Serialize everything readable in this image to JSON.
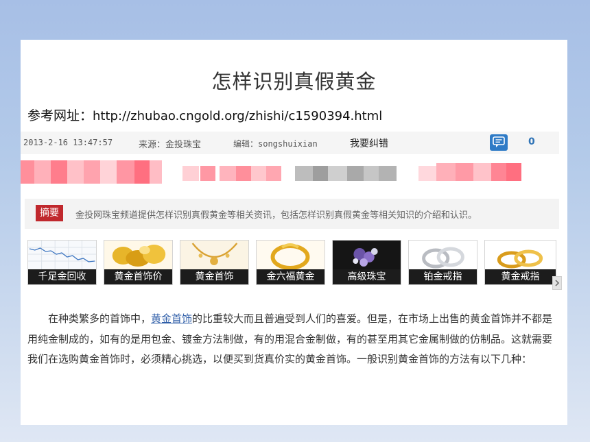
{
  "article": {
    "title": "怎样识别真假黄金",
    "reference_label": "参考网址：",
    "reference_url": "http://zhubao.cngold.org/zhishi/c1590394.html"
  },
  "meta": {
    "datetime": "2013-2-16 13:47:57",
    "source": "来源：金投珠宝",
    "editor": "编辑：songshuixian",
    "report_error": "我要纠错",
    "comment_count": "0",
    "comment_icon": "comment-bubble-icon"
  },
  "summary": {
    "tag": "摘要",
    "text": "金投网珠宝频道提供怎样识别真假黄金等相关资讯，包括怎样识别真假黄金等相关知识的介绍和认识。"
  },
  "thumbnails": [
    {
      "label": "千足金回收"
    },
    {
      "label": "黄金首饰价"
    },
    {
      "label": "黄金首饰"
    },
    {
      "label": "金六福黄金"
    },
    {
      "label": "高级珠宝"
    },
    {
      "label": "铂金戒指"
    },
    {
      "label": "黄金戒指"
    }
  ],
  "body": {
    "p1_before": "在种类繁多的首饰中，",
    "p1_link": "黄金首饰",
    "p1_after": "的比重较大而且普遍受到人们的喜爱。但是，在市场上出售的黄金首饰并不都是用纯金制成的，如有的是用包金、镀金方法制做，有的用混合金制做，有的甚至用其它金属制做的仿制品。这就需要我们在选购黄金首饰时，必须精心挑选，以便买到货真价实的黄金首饰。一般识别黄金首饰的方法有以下几种："
  },
  "colors": {
    "summary_tag_bg": "#c0282d",
    "link": "#2f5ea8",
    "comment_button": "#2f7bc6"
  }
}
